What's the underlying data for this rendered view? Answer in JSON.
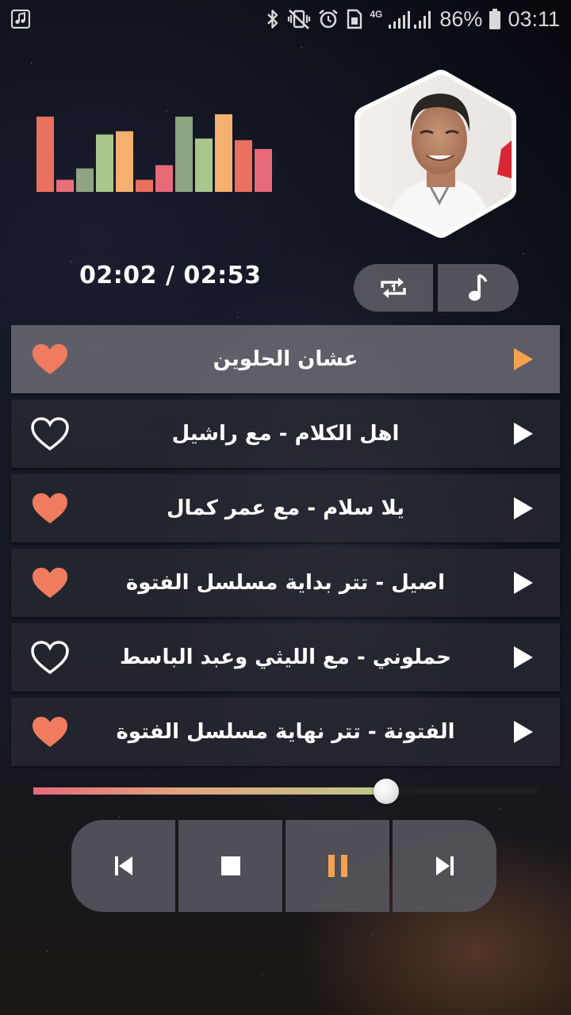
{
  "status_bar": {
    "network": "4G",
    "battery": "86%",
    "time": "03:11",
    "icons": [
      "music-app-icon",
      "bluetooth-icon",
      "vibrate-mute-icon",
      "alarm-icon",
      "sim-card-icon",
      "signal-icon",
      "battery-icon"
    ]
  },
  "player": {
    "elapsed": "02:02",
    "duration": "02:53",
    "separator": " / ",
    "progress_fraction": 0.7,
    "visualizer_levels": [
      0.93,
      0.15,
      0.29,
      0.71,
      0.75,
      0.15,
      0.33,
      0.93,
      0.66,
      0.96,
      0.64,
      0.53
    ],
    "visualizer_colors": [
      "#ea705f",
      "#e8707a",
      "#8ea482",
      "#a9c68c",
      "#f4b06e",
      "#ea705f",
      "#e66a78",
      "#8ea482",
      "#a9c68c",
      "#f4b06e",
      "#ea705f",
      "#e66a78"
    ],
    "repeat_mode_icon": "repeat-one-icon",
    "music_icon": "music-note-icon"
  },
  "tracks": [
    {
      "title": "عشان الحلوين",
      "favorite": true,
      "active": true
    },
    {
      "title": "اهل الكلام - مع راشيل",
      "favorite": false,
      "active": false
    },
    {
      "title": "يلا سلام - مع عمر كمال",
      "favorite": true,
      "active": false
    },
    {
      "title": "اصيل - تتر بداية مسلسل الفتوة",
      "favorite": true,
      "active": false
    },
    {
      "title": "حملوني - مع الليثي وعبد الباسط",
      "favorite": false,
      "active": false
    },
    {
      "title": "الفتونة - تتر نهاية مسلسل الفتوة",
      "favorite": true,
      "active": false
    }
  ],
  "controls": {
    "buttons": [
      "skip-previous-icon",
      "stop-icon",
      "pause-icon",
      "skip-next-icon"
    ]
  },
  "colors": {
    "heart": "#f07c5f",
    "active_play": "#f4a24e",
    "pause": "#f4a24e",
    "white": "#ffffff"
  }
}
